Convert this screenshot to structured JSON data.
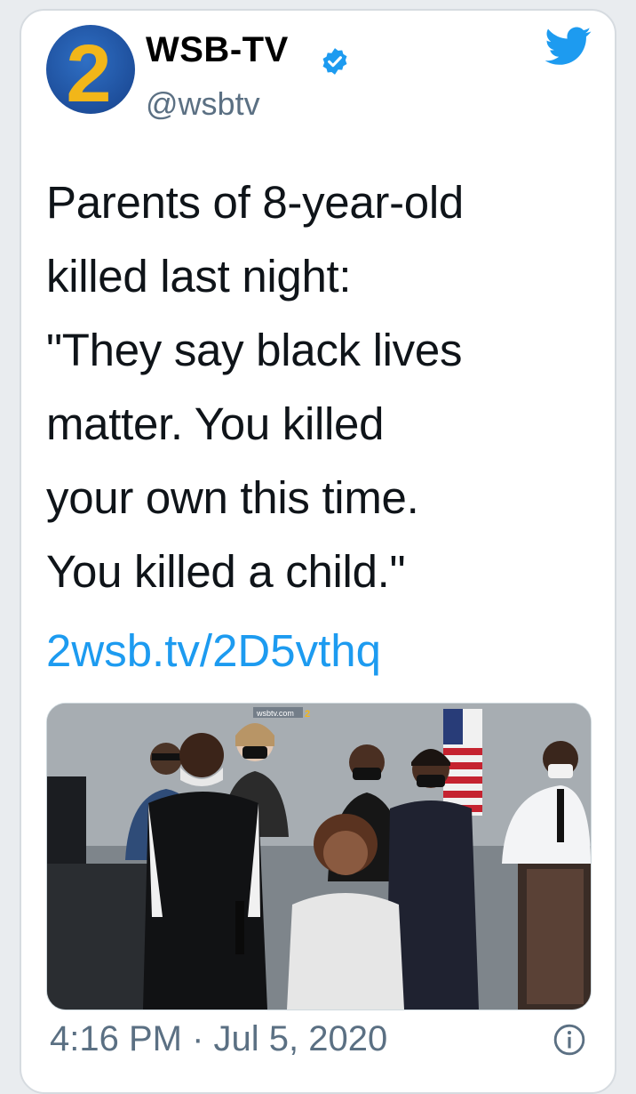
{
  "account": {
    "name": "WSB-TV",
    "handle": "@wsbtv",
    "avatar_text": "2",
    "verified": true
  },
  "tweet": {
    "lines": [
      "Parents of 8-year-old",
      "killed last night:",
      "\"They say black lives",
      "matter. You killed",
      "your own this time.",
      "You killed a child.\""
    ],
    "link": "2wsb.tv/2D5vthq",
    "media_watermark": "wsbtv.com"
  },
  "footer": {
    "timestamp": "4:16 PM · Jul 5, 2020"
  },
  "colors": {
    "link": "#1d9bf0",
    "twitter_blue": "#1d9bf0",
    "muted": "#5b7083",
    "avatar_blue": "#1e4f9c",
    "avatar_gold": "#f2b619"
  },
  "icons": [
    "twitter-bird-icon",
    "verified-badge-icon",
    "info-icon"
  ]
}
